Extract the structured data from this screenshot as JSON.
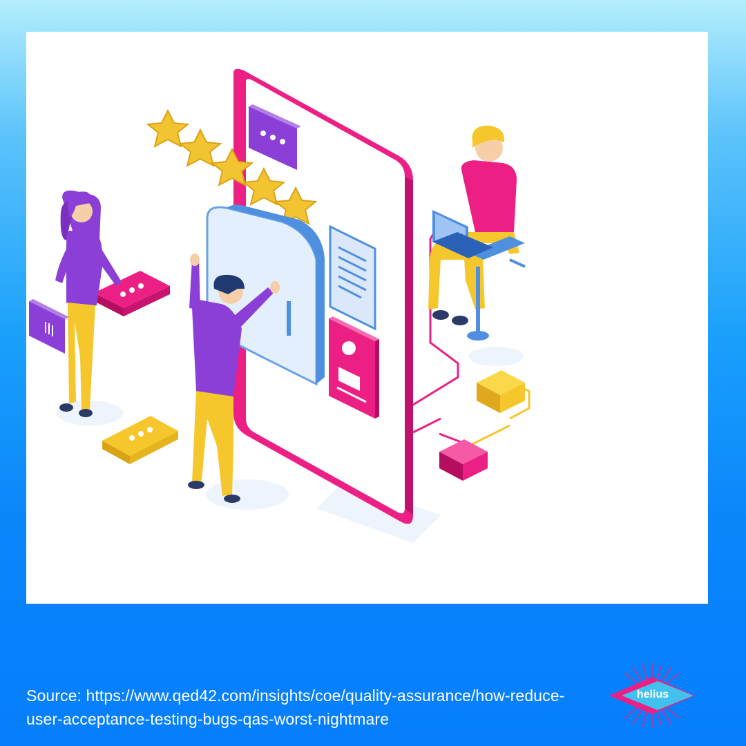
{
  "caption": {
    "line1": "Source: https://www.qed42.com/insights/coe/quality-assurance/how-reduce-",
    "line2": "user-acceptance-testing-bugs-qas-worst-nightmare"
  },
  "logo": {
    "text": "helius"
  },
  "illustration": {
    "rating_stars": 5,
    "icons": [
      "phone-frame",
      "chat-bubble-icon",
      "star-icon",
      "document-icon",
      "user-profile-icon",
      "laptop-icon",
      "server-cube-icon"
    ]
  },
  "colors": {
    "background_top": "#b4eefc",
    "background_bottom": "#067efc",
    "phone": "#ec1f84",
    "purple": "#8b3fd6",
    "yellow": "#f6c72c",
    "star": "#f3c431"
  }
}
